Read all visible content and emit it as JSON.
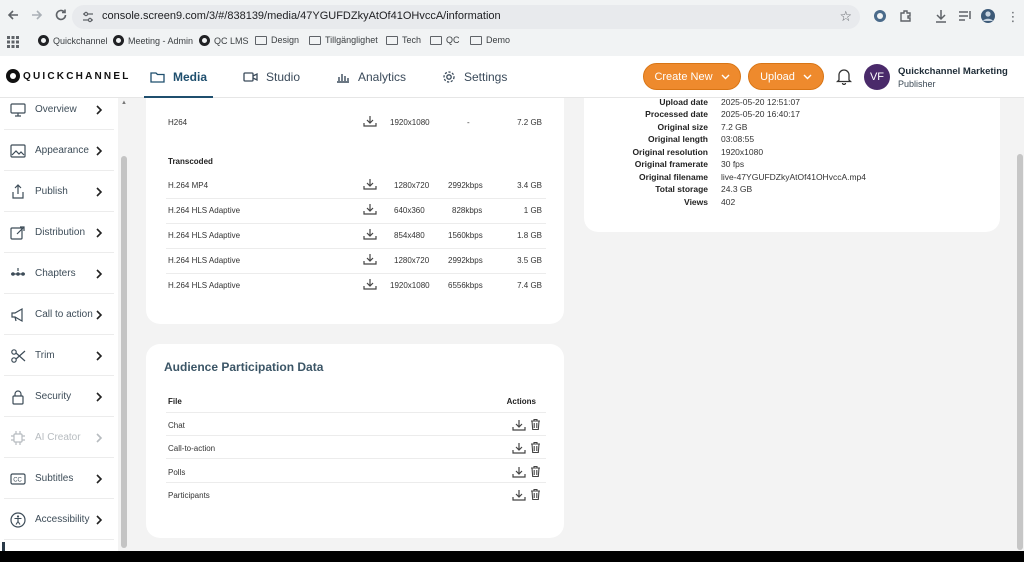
{
  "browser": {
    "url": "console.screen9.com/3/#/838139/media/47YGUFDZkyAtOf41OHvccA/information",
    "bookmarks": [
      "Quickchannel",
      "Meeting - Admin",
      "QC LMS",
      "Design",
      "Tillgänglighet",
      "Tech",
      "QC",
      "Demo"
    ]
  },
  "header": {
    "logo": "QUICKCHANNEL",
    "tabs": [
      {
        "label": "Media",
        "active": true
      },
      {
        "label": "Studio",
        "active": false
      },
      {
        "label": "Analytics",
        "active": false
      },
      {
        "label": "Settings",
        "active": false
      }
    ],
    "create_new": "Create New",
    "upload": "Upload",
    "avatar_initials": "VF",
    "user_name": "Quickchannel Marketing",
    "user_role": "Publisher",
    "accent": "#ee8a2d"
  },
  "sidebar": {
    "items": [
      {
        "label": "Overview",
        "icon": "monitor-icon",
        "enabled": true
      },
      {
        "label": "Appearance",
        "icon": "image-icon",
        "enabled": true
      },
      {
        "label": "Publish",
        "icon": "share-icon",
        "enabled": true
      },
      {
        "label": "Distribution",
        "icon": "distribution-icon",
        "enabled": true
      },
      {
        "label": "Chapters",
        "icon": "chapters-icon",
        "enabled": true
      },
      {
        "label": "Call to action",
        "icon": "megaphone-icon",
        "enabled": true
      },
      {
        "label": "Trim",
        "icon": "scissors-icon",
        "enabled": true
      },
      {
        "label": "Security",
        "icon": "lock-icon",
        "enabled": true
      },
      {
        "label": "AI Creator",
        "icon": "chip-icon",
        "enabled": false
      },
      {
        "label": "Subtitles",
        "icon": "cc-icon",
        "enabled": true
      },
      {
        "label": "Accessibility",
        "icon": "accessibility-icon",
        "enabled": true
      }
    ]
  },
  "original": {
    "row": {
      "codec": "H264",
      "resolution": "1920x1080",
      "bitrate": "-",
      "size": "7.2 GB"
    }
  },
  "transcoded": {
    "title": "Transcoded",
    "rows": [
      {
        "codec": "H.264 MP4",
        "resolution": "1280x720",
        "bitrate": "2992kbps",
        "size": "3.4 GB"
      },
      {
        "codec": "H.264 HLS Adaptive",
        "resolution": "640x360",
        "bitrate": "828kbps",
        "size": "1 GB"
      },
      {
        "codec": "H.264 HLS Adaptive",
        "resolution": "854x480",
        "bitrate": "1560kbps",
        "size": "1.8 GB"
      },
      {
        "codec": "H.264 HLS Adaptive",
        "resolution": "1280x720",
        "bitrate": "2992kbps",
        "size": "3.5 GB"
      },
      {
        "codec": "H.264 HLS Adaptive",
        "resolution": "1920x1080",
        "bitrate": "6556kbps",
        "size": "7.4 GB"
      }
    ]
  },
  "info": {
    "rows": [
      {
        "label": "Upload date",
        "value": "2025-05-20 12:51:07"
      },
      {
        "label": "Processed date",
        "value": "2025-05-20 16:40:17"
      },
      {
        "label": "Original size",
        "value": "7.2 GB"
      },
      {
        "label": "Original length",
        "value": "03:08:55"
      },
      {
        "label": "Original resolution",
        "value": "1920x1080"
      },
      {
        "label": "Original framerate",
        "value": "30 fps"
      },
      {
        "label": "Original filename",
        "value": "live-47YGUFDZkyAtOf41OHvccA.mp4"
      },
      {
        "label": "Total storage",
        "value": "24.3 GB"
      },
      {
        "label": "Views",
        "value": "402"
      }
    ]
  },
  "audience": {
    "title": "Audience Participation Data",
    "col_file": "File",
    "col_actions": "Actions",
    "rows": [
      "Chat",
      "Call-to-action",
      "Polls",
      "Participants"
    ]
  }
}
